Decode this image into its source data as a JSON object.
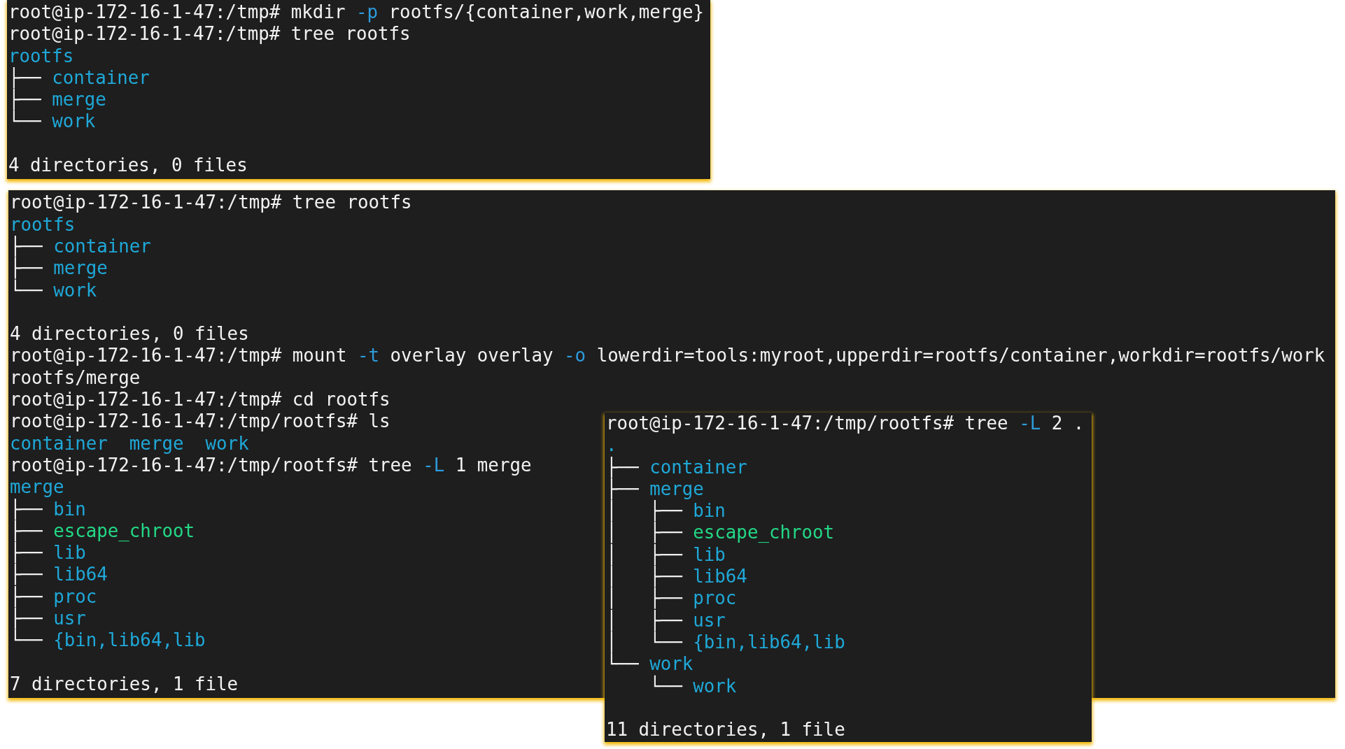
{
  "panels": [
    {
      "lines": [
        {
          "kind": "text",
          "segments": [
            {
              "text": "root@ip-172-16-1-47:/tmp# mkdir ",
              "kind": "plain"
            },
            {
              "text": "-p",
              "kind": "option"
            },
            {
              "text": " rootfs/{container,work,merge}",
              "kind": "plain"
            }
          ]
        },
        {
          "kind": "text",
          "segments": [
            {
              "text": "root@ip-172-16-1-47:/tmp# tree rootfs",
              "kind": "plain"
            }
          ]
        },
        {
          "kind": "text",
          "segments": [
            {
              "text": "rootfs",
              "kind": "dir"
            }
          ]
        },
        {
          "kind": "text",
          "segments": [
            {
              "text": "├── ",
              "kind": "plain"
            },
            {
              "text": "container",
              "kind": "dir"
            }
          ]
        },
        {
          "kind": "text",
          "segments": [
            {
              "text": "├── ",
              "kind": "plain"
            },
            {
              "text": "merge",
              "kind": "dir"
            }
          ]
        },
        {
          "kind": "text",
          "segments": [
            {
              "text": "└── ",
              "kind": "plain"
            },
            {
              "text": "work",
              "kind": "dir"
            }
          ]
        },
        {
          "kind": "blank"
        },
        {
          "kind": "text",
          "segments": [
            {
              "text": "4 directories, 0 files",
              "kind": "plain"
            }
          ]
        }
      ]
    },
    {
      "lines": [
        {
          "kind": "text",
          "segments": [
            {
              "text": "root@ip-172-16-1-47:/tmp# tree rootfs",
              "kind": "plain"
            }
          ]
        },
        {
          "kind": "text",
          "segments": [
            {
              "text": "rootfs",
              "kind": "dir"
            }
          ]
        },
        {
          "kind": "text",
          "segments": [
            {
              "text": "├── ",
              "kind": "plain"
            },
            {
              "text": "container",
              "kind": "dir"
            }
          ]
        },
        {
          "kind": "text",
          "segments": [
            {
              "text": "├── ",
              "kind": "plain"
            },
            {
              "text": "merge",
              "kind": "dir"
            }
          ]
        },
        {
          "kind": "text",
          "segments": [
            {
              "text": "└── ",
              "kind": "plain"
            },
            {
              "text": "work",
              "kind": "dir"
            }
          ]
        },
        {
          "kind": "blank"
        },
        {
          "kind": "text",
          "segments": [
            {
              "text": "4 directories, 0 files",
              "kind": "plain"
            }
          ]
        },
        {
          "kind": "text",
          "segments": [
            {
              "text": "root@ip-172-16-1-47:/tmp# mount ",
              "kind": "plain"
            },
            {
              "text": "-t",
              "kind": "option"
            },
            {
              "text": " overlay overlay ",
              "kind": "plain"
            },
            {
              "text": "-o",
              "kind": "option"
            },
            {
              "text": " lowerdir=tools:myroot,upperdir=rootfs/container,workdir=rootfs/work",
              "kind": "plain"
            }
          ]
        },
        {
          "kind": "text",
          "segments": [
            {
              "text": "rootfs/merge",
              "kind": "plain"
            }
          ]
        },
        {
          "kind": "text",
          "segments": [
            {
              "text": "root@ip-172-16-1-47:/tmp# cd rootfs",
              "kind": "plain"
            }
          ]
        },
        {
          "kind": "text",
          "segments": [
            {
              "text": "root@ip-172-16-1-47:/tmp/rootfs# ls",
              "kind": "plain"
            }
          ]
        },
        {
          "kind": "text",
          "segments": [
            {
              "text": "container  merge  work",
              "kind": "dir"
            }
          ]
        },
        {
          "kind": "text",
          "segments": [
            {
              "text": "root@ip-172-16-1-47:/tmp/rootfs# tree ",
              "kind": "plain"
            },
            {
              "text": "-L",
              "kind": "option"
            },
            {
              "text": " 1 merge",
              "kind": "plain"
            }
          ]
        },
        {
          "kind": "text",
          "segments": [
            {
              "text": "merge",
              "kind": "dir"
            }
          ]
        },
        {
          "kind": "text",
          "segments": [
            {
              "text": "├── ",
              "kind": "plain"
            },
            {
              "text": "bin",
              "kind": "dir"
            }
          ]
        },
        {
          "kind": "text",
          "segments": [
            {
              "text": "├── ",
              "kind": "plain"
            },
            {
              "text": "escape_chroot",
              "kind": "exec"
            }
          ]
        },
        {
          "kind": "text",
          "segments": [
            {
              "text": "├── ",
              "kind": "plain"
            },
            {
              "text": "lib",
              "kind": "dir"
            }
          ]
        },
        {
          "kind": "text",
          "segments": [
            {
              "text": "├── ",
              "kind": "plain"
            },
            {
              "text": "lib64",
              "kind": "dir"
            }
          ]
        },
        {
          "kind": "text",
          "segments": [
            {
              "text": "├── ",
              "kind": "plain"
            },
            {
              "text": "proc",
              "kind": "dir"
            }
          ]
        },
        {
          "kind": "text",
          "segments": [
            {
              "text": "├── ",
              "kind": "plain"
            },
            {
              "text": "usr",
              "kind": "dir"
            }
          ]
        },
        {
          "kind": "text",
          "segments": [
            {
              "text": "└── ",
              "kind": "plain"
            },
            {
              "text": "{bin,lib64,lib",
              "kind": "dir"
            }
          ]
        },
        {
          "kind": "blank"
        },
        {
          "kind": "text",
          "segments": [
            {
              "text": "7 directories, 1 file",
              "kind": "plain"
            }
          ]
        }
      ]
    },
    {
      "lines": [
        {
          "kind": "text",
          "segments": [
            {
              "text": "root@ip-172-16-1-47:/tmp/rootfs# tree ",
              "kind": "plain"
            },
            {
              "text": "-L",
              "kind": "option"
            },
            {
              "text": " 2 .",
              "kind": "plain"
            }
          ]
        },
        {
          "kind": "text",
          "segments": [
            {
              "text": ".",
              "kind": "dir"
            }
          ]
        },
        {
          "kind": "text",
          "segments": [
            {
              "text": "├── ",
              "kind": "plain"
            },
            {
              "text": "container",
              "kind": "dir"
            }
          ]
        },
        {
          "kind": "text",
          "segments": [
            {
              "text": "├── ",
              "kind": "plain"
            },
            {
              "text": "merge",
              "kind": "dir"
            }
          ]
        },
        {
          "kind": "text",
          "segments": [
            {
              "text": "│   ├── ",
              "kind": "plain"
            },
            {
              "text": "bin",
              "kind": "dir"
            }
          ]
        },
        {
          "kind": "text",
          "segments": [
            {
              "text": "│   ├── ",
              "kind": "plain"
            },
            {
              "text": "escape_chroot",
              "kind": "exec"
            }
          ]
        },
        {
          "kind": "text",
          "segments": [
            {
              "text": "│   ├── ",
              "kind": "plain"
            },
            {
              "text": "lib",
              "kind": "dir"
            }
          ]
        },
        {
          "kind": "text",
          "segments": [
            {
              "text": "│   ├── ",
              "kind": "plain"
            },
            {
              "text": "lib64",
              "kind": "dir"
            }
          ]
        },
        {
          "kind": "text",
          "segments": [
            {
              "text": "│   ├── ",
              "kind": "plain"
            },
            {
              "text": "proc",
              "kind": "dir"
            }
          ]
        },
        {
          "kind": "text",
          "segments": [
            {
              "text": "│   ├── ",
              "kind": "plain"
            },
            {
              "text": "usr",
              "kind": "dir"
            }
          ]
        },
        {
          "kind": "text",
          "segments": [
            {
              "text": "│   └── ",
              "kind": "plain"
            },
            {
              "text": "{bin,lib64,lib",
              "kind": "dir"
            }
          ]
        },
        {
          "kind": "text",
          "segments": [
            {
              "text": "└── ",
              "kind": "plain"
            },
            {
              "text": "work",
              "kind": "dir"
            }
          ]
        },
        {
          "kind": "text",
          "segments": [
            {
              "text": "    └── ",
              "kind": "plain"
            },
            {
              "text": "work",
              "kind": "dir"
            }
          ]
        },
        {
          "kind": "blank"
        },
        {
          "kind": "text",
          "segments": [
            {
              "text": "11 directories, 1 file",
              "kind": "plain"
            }
          ]
        }
      ]
    }
  ]
}
